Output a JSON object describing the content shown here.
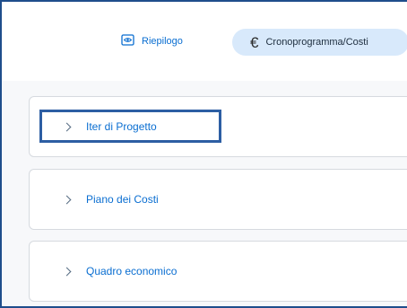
{
  "tabs": [
    {
      "label": "Riepilogo",
      "icon": "eye-icon",
      "selected": false
    },
    {
      "label": "Cronoprogramma/Costi",
      "icon": "euro-icon",
      "selected": true
    }
  ],
  "panels": [
    {
      "label": "Iter di Progetto",
      "expanded": false
    },
    {
      "label": "Piano dei Costi",
      "expanded": false
    },
    {
      "label": "Quadro economico",
      "expanded": false
    }
  ],
  "colors": {
    "accent": "#0a6ed1",
    "selected_tab_bg": "#d8e9fb",
    "highlight_border": "#2d5ea3"
  }
}
